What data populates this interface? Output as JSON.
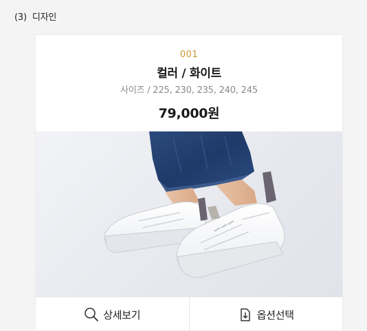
{
  "section": {
    "number": "(3)",
    "title": "디자인"
  },
  "product": {
    "code": "001",
    "name": "컬러 / 화이트",
    "sizes": "사이즈 / 225, 230, 235, 240, 245",
    "price": "79,000원",
    "image_alt": "white sneakers with blue jeans",
    "accent_color": "#c69a2b"
  },
  "actions": {
    "detail": {
      "label": "상세보기",
      "icon": "search-icon"
    },
    "option": {
      "label": "옵션선택",
      "icon": "download-icon"
    }
  }
}
